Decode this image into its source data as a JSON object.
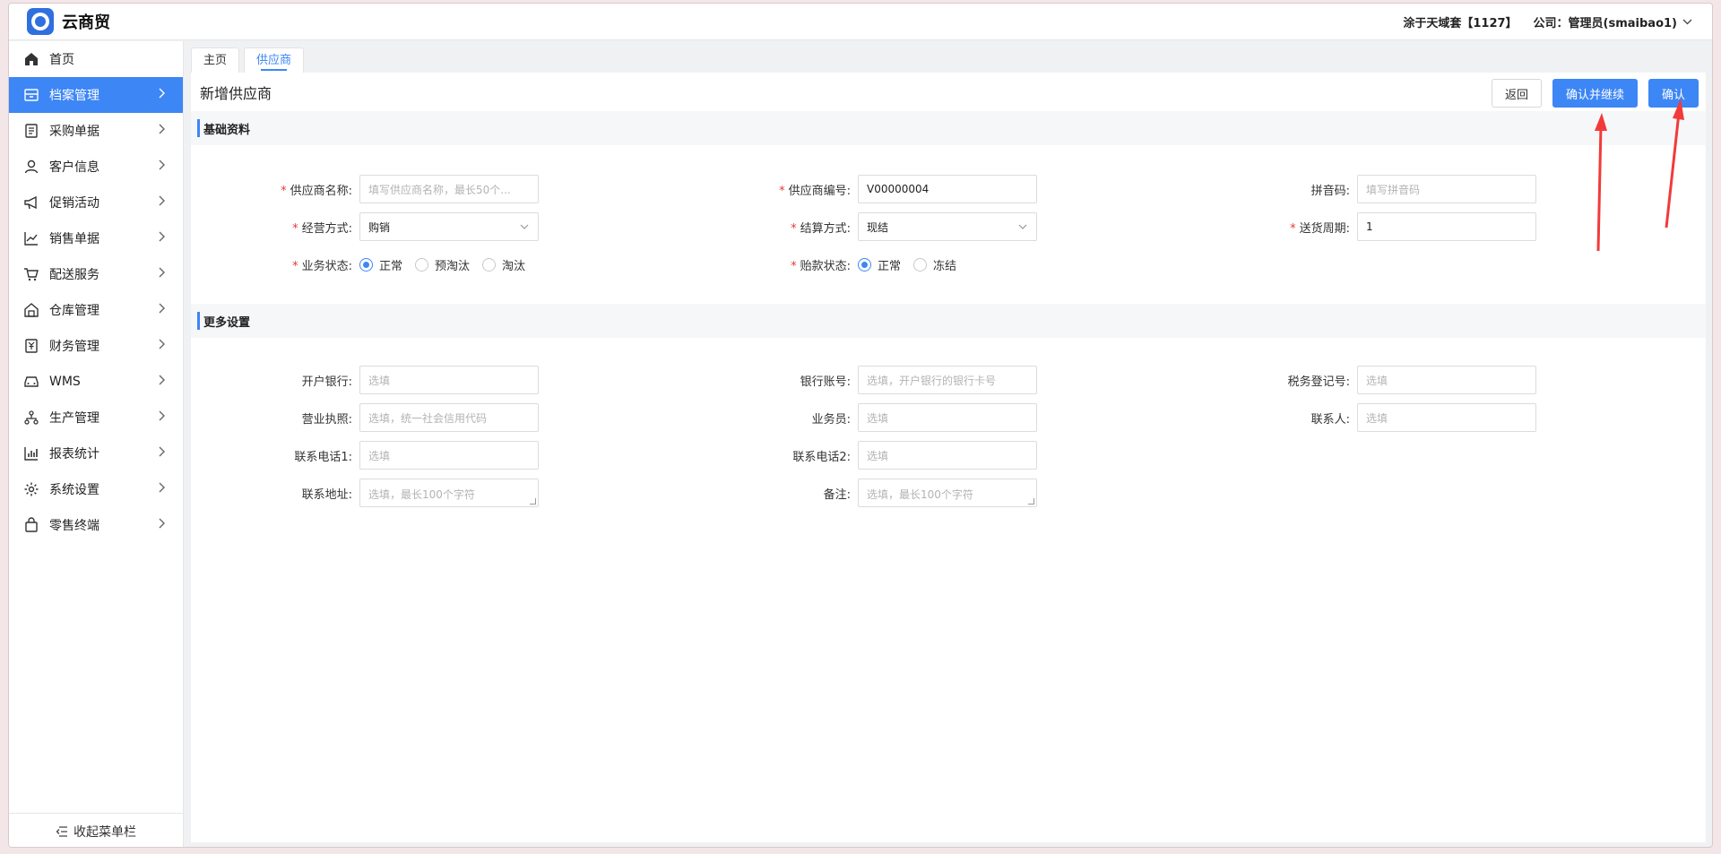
{
  "app": {
    "brand": "云商贸"
  },
  "topbar": {
    "account": "涂于天域套【1127】",
    "company": "公司：管理员(smaibao1)"
  },
  "sidebar": {
    "items": [
      {
        "label": "首页",
        "icon": "home-icon",
        "has_arrow": false,
        "active": false
      },
      {
        "label": "档案管理",
        "icon": "archive-icon",
        "has_arrow": true,
        "active": true
      },
      {
        "label": "采购单据",
        "icon": "purchase-doc-icon",
        "has_arrow": true,
        "active": false
      },
      {
        "label": "客户信息",
        "icon": "user-icon",
        "has_arrow": true,
        "active": false
      },
      {
        "label": "促销活动",
        "icon": "megaphone-icon",
        "has_arrow": true,
        "active": false
      },
      {
        "label": "销售单据",
        "icon": "line-chart-icon",
        "has_arrow": true,
        "active": false
      },
      {
        "label": "配送服务",
        "icon": "cart-icon",
        "has_arrow": true,
        "active": false
      },
      {
        "label": "仓库管理",
        "icon": "warehouse-icon",
        "has_arrow": true,
        "active": false
      },
      {
        "label": "财务管理",
        "icon": "finance-icon",
        "has_arrow": true,
        "active": false
      },
      {
        "label": "WMS",
        "icon": "car-icon",
        "has_arrow": true,
        "active": false
      },
      {
        "label": "生产管理",
        "icon": "network-icon",
        "has_arrow": true,
        "active": false
      },
      {
        "label": "报表统计",
        "icon": "bar-chart-icon",
        "has_arrow": true,
        "active": false
      },
      {
        "label": "系统设置",
        "icon": "gear-icon",
        "has_arrow": true,
        "active": false
      },
      {
        "label": "零售终端",
        "icon": "bag-icon",
        "has_arrow": true,
        "active": false
      }
    ],
    "collapse_label": "收起菜单栏"
  },
  "tabs": [
    {
      "label": "主页",
      "active": false
    },
    {
      "label": "供应商",
      "active": true
    }
  ],
  "page": {
    "title": "新增供应商",
    "buttons": {
      "back": "返回",
      "confirm_continue": "确认并继续",
      "confirm": "确认"
    }
  },
  "basic": {
    "section_title": "基础资料",
    "supplier_name": {
      "label": "供应商名称:",
      "placeholder": "填写供应商名称，最长50个..."
    },
    "supplier_code": {
      "label": "供应商编号:",
      "value": "V00000004"
    },
    "pinyin": {
      "label": "拼音码:",
      "placeholder": "填写拼音码"
    },
    "business_mode": {
      "label": "经营方式:",
      "value": "购销"
    },
    "settlement": {
      "label": "结算方式:",
      "value": "现结"
    },
    "delivery_cycle": {
      "label": "送货周期:",
      "value": "1"
    },
    "business_status": {
      "label": "业务状态:",
      "options": [
        "正常",
        "预淘汰",
        "淘汰"
      ],
      "selected": "正常"
    },
    "payment_status": {
      "label": "贻款状态:",
      "options": [
        "正常",
        "冻结"
      ],
      "selected": "正常"
    }
  },
  "more": {
    "section_title": "更多设置",
    "bank": {
      "label": "开户银行:",
      "placeholder": "选填"
    },
    "bank_account": {
      "label": "银行账号:",
      "placeholder": "选填，开户银行的银行卡号"
    },
    "tax_no": {
      "label": "税务登记号:",
      "placeholder": "选填"
    },
    "license": {
      "label": "营业执照:",
      "placeholder": "选填，统一社会信用代码"
    },
    "salesman": {
      "label": "业务员:",
      "placeholder": "选填"
    },
    "contact": {
      "label": "联系人:",
      "placeholder": "选填"
    },
    "phone1": {
      "label": "联系电话1:",
      "placeholder": "选填"
    },
    "phone2": {
      "label": "联系电话2:",
      "placeholder": "选填"
    },
    "address": {
      "label": "联系地址:",
      "placeholder": "选填，最长100个字符"
    },
    "remark": {
      "label": "备注:",
      "placeholder": "选填，最长100个字符"
    }
  },
  "colors": {
    "primary": "#3d86f5",
    "required": "#e53935",
    "annotation_arrow": "#f23a3a"
  }
}
